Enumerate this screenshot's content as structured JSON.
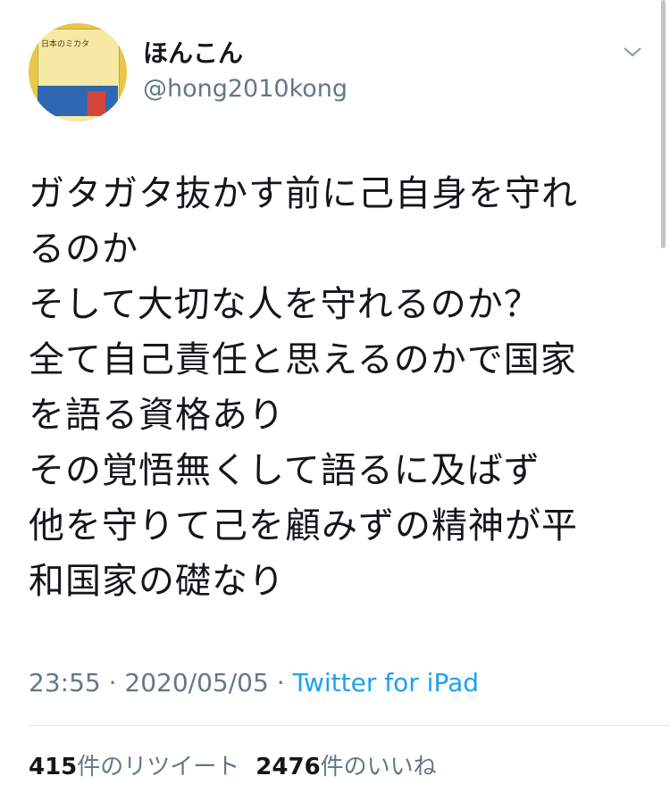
{
  "author": {
    "avatar_book_title": "日本のミカタ",
    "display_name": "ほんこん",
    "handle": "@hong2010kong"
  },
  "tweet": {
    "lines": [
      "ガタガタ抜かす前に己自身を守れ",
      "るのか",
      "そして大切な人を守れるのか？",
      "全て自己責任と思えるのかで国家",
      "を語る資格あり",
      "その覚悟無くして語るに及ばず",
      "他を守りて己を顧みずの精神が平",
      "和国家の礎なり"
    ],
    "time": "23:55",
    "separator": "·",
    "date": "2020/05/05",
    "source": "Twitter for iPad"
  },
  "stats": {
    "retweet_count": "415",
    "retweet_label": "件のリツイート",
    "like_count": "2476",
    "like_label": "件のいいね"
  },
  "icons": {
    "menu": "chevron-down-icon"
  }
}
